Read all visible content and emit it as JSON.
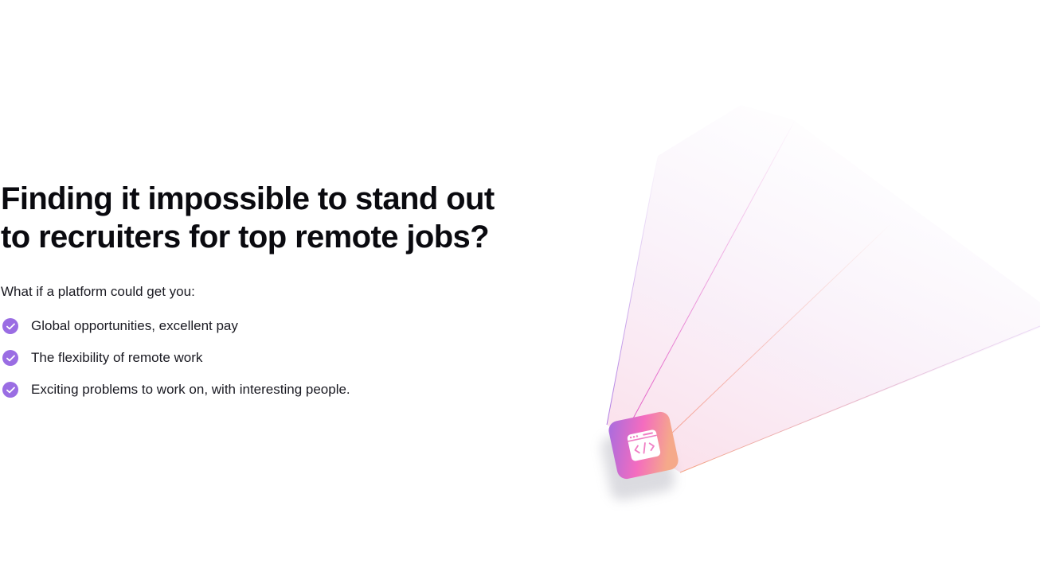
{
  "hero": {
    "headline": "Finding it impossible to stand out to recruiters for top remote jobs?",
    "lead": "What if a platform could get you:",
    "benefits": [
      {
        "label": "Global opportunities, excellent pay",
        "icon": "check-circle-icon"
      },
      {
        "label": "The flexibility of remote work",
        "icon": "check-circle-icon"
      },
      {
        "label": "Exciting problems to work on, with interesting people.",
        "icon": "check-circle-icon"
      }
    ]
  },
  "illustration": {
    "icon": "code-window-icon",
    "colors": {
      "check": "#9a6de3",
      "gradient_start": "#a56ce0",
      "gradient_mid": "#f46cbf",
      "gradient_end": "#f5a98a"
    }
  }
}
